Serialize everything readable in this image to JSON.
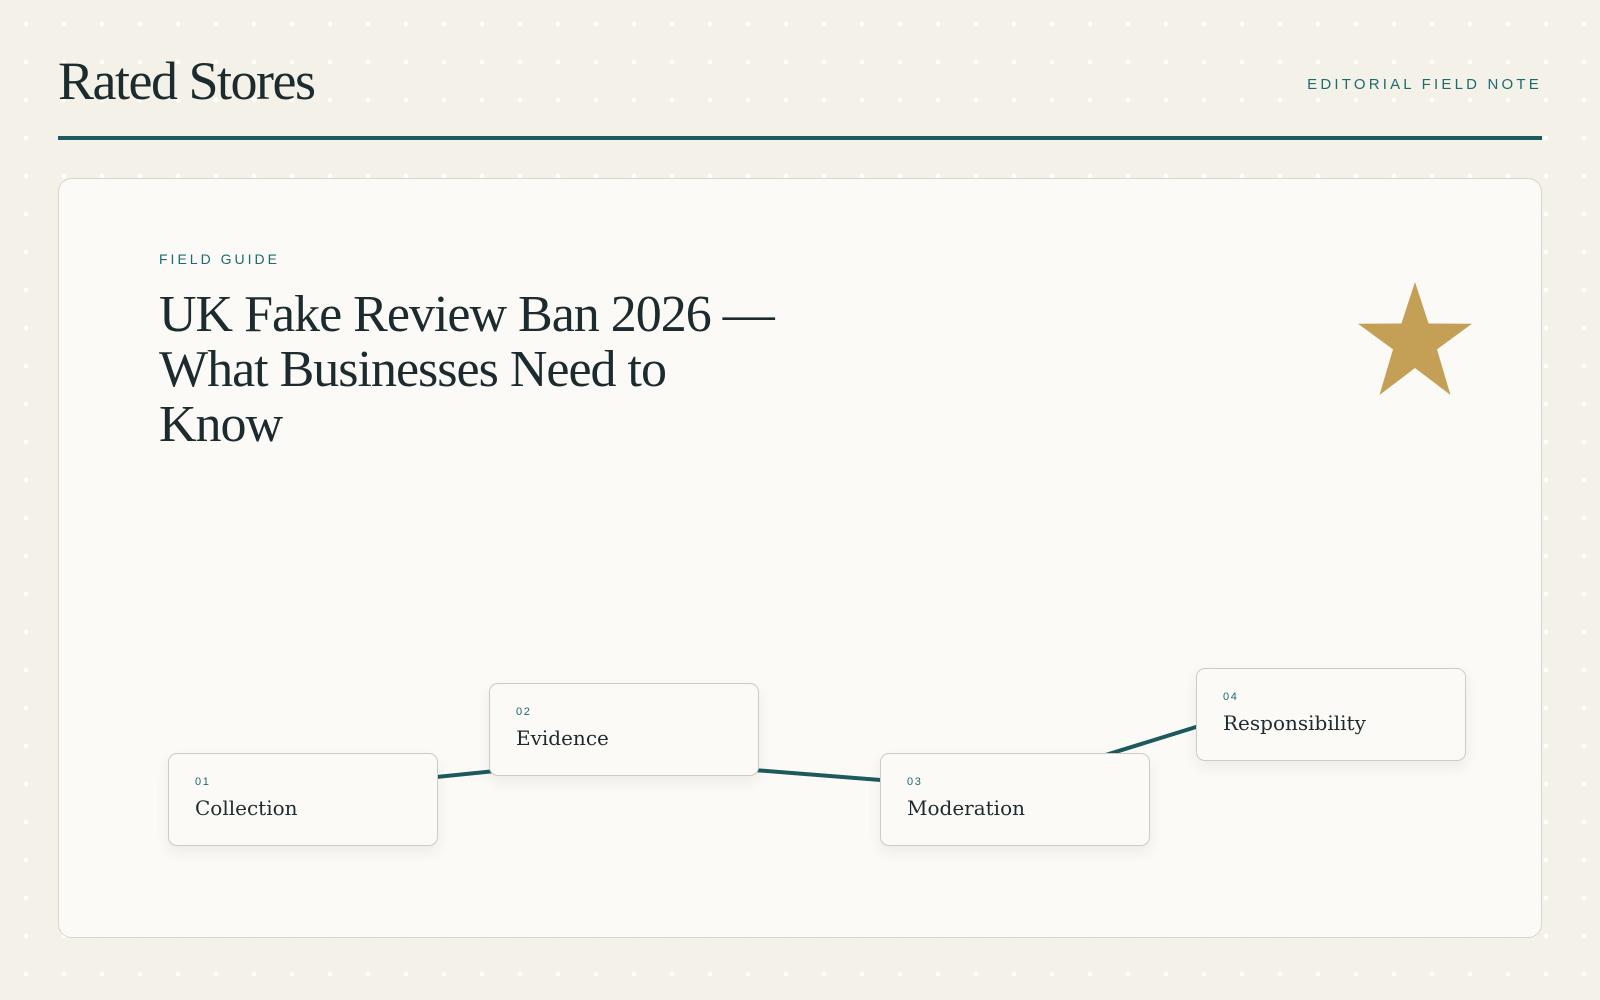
{
  "header": {
    "brand": "Rated Stores",
    "tag": "EDITORIAL FIELD NOTE"
  },
  "card": {
    "eyebrow": "FIELD GUIDE",
    "title": "UK Fake Review Ban 2026 — What Businesses Need to Know",
    "icon": "star-icon",
    "steps": [
      {
        "number": "01",
        "label": "Collection"
      },
      {
        "number": "02",
        "label": "Evidence"
      },
      {
        "number": "03",
        "label": "Moderation"
      },
      {
        "number": "04",
        "label": "Responsibility"
      }
    ]
  },
  "colors": {
    "background": "#f4f1e8",
    "card": "#fbfaf6",
    "ink": "#1c2b2e",
    "accent": "#1c5a5e",
    "label_accent": "#1c6b70",
    "star": "#c4a057"
  }
}
